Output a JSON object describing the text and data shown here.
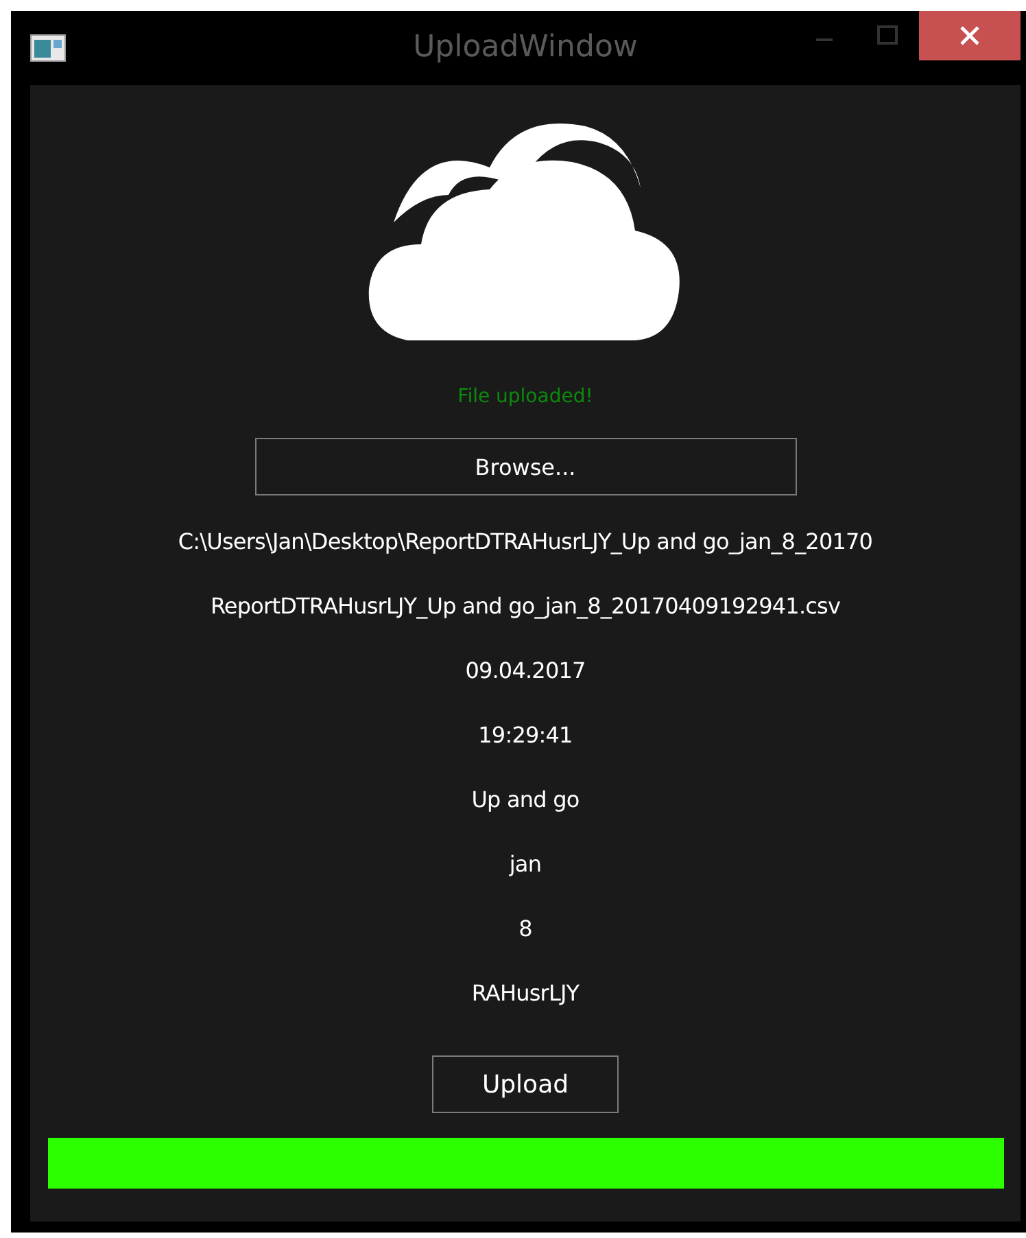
{
  "window": {
    "title": "UploadWindow"
  },
  "status": "File uploaded!",
  "browse_button": "Browse...",
  "file_info": [
    "C:\\Users\\Jan\\Desktop\\ReportDTRAHusrLJY_Up and go_jan_8_20170",
    "ReportDTRAHusrLJY_Up and go_jan_8_20170409192941.csv",
    "09.04.2017",
    "19:29:41",
    "Up and go",
    "jan",
    "8",
    "RAHusrLJY"
  ],
  "upload_button": "Upload",
  "progress": {
    "level": 1
  }
}
